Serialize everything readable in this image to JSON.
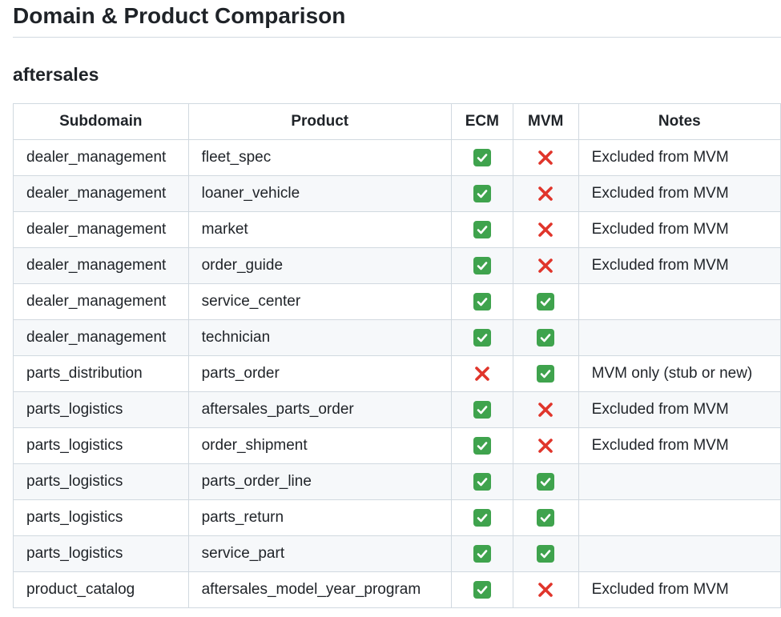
{
  "page_title": "Domain & Product Comparison",
  "section_heading": "aftersales",
  "table": {
    "headers": [
      "Subdomain",
      "Product",
      "ECM",
      "MVM",
      "Notes"
    ],
    "rows": [
      {
        "subdomain": "dealer_management",
        "product": "fleet_spec",
        "ecm": true,
        "mvm": false,
        "notes": "Excluded from MVM"
      },
      {
        "subdomain": "dealer_management",
        "product": "loaner_vehicle",
        "ecm": true,
        "mvm": false,
        "notes": "Excluded from MVM"
      },
      {
        "subdomain": "dealer_management",
        "product": "market",
        "ecm": true,
        "mvm": false,
        "notes": "Excluded from MVM"
      },
      {
        "subdomain": "dealer_management",
        "product": "order_guide",
        "ecm": true,
        "mvm": false,
        "notes": "Excluded from MVM"
      },
      {
        "subdomain": "dealer_management",
        "product": "service_center",
        "ecm": true,
        "mvm": true,
        "notes": ""
      },
      {
        "subdomain": "dealer_management",
        "product": "technician",
        "ecm": true,
        "mvm": true,
        "notes": ""
      },
      {
        "subdomain": "parts_distribution",
        "product": "parts_order",
        "ecm": false,
        "mvm": true,
        "notes": "MVM only (stub or new)"
      },
      {
        "subdomain": "parts_logistics",
        "product": "aftersales_parts_order",
        "ecm": true,
        "mvm": false,
        "notes": "Excluded from MVM"
      },
      {
        "subdomain": "parts_logistics",
        "product": "order_shipment",
        "ecm": true,
        "mvm": false,
        "notes": "Excluded from MVM"
      },
      {
        "subdomain": "parts_logistics",
        "product": "parts_order_line",
        "ecm": true,
        "mvm": true,
        "notes": ""
      },
      {
        "subdomain": "parts_logistics",
        "product": "parts_return",
        "ecm": true,
        "mvm": true,
        "notes": ""
      },
      {
        "subdomain": "parts_logistics",
        "product": "service_part",
        "ecm": true,
        "mvm": true,
        "notes": ""
      },
      {
        "subdomain": "product_catalog",
        "product": "aftersales_model_year_program",
        "ecm": true,
        "mvm": false,
        "notes": "Excluded from MVM"
      }
    ]
  },
  "icons": {
    "present": "check-mark-icon",
    "absent": "cross-mark-icon"
  },
  "colors": {
    "check_bg": "#3fa34d",
    "cross": "#e0352b",
    "text": "#1f2328",
    "border": "#d1d9e0",
    "stripe": "#f6f8fa"
  }
}
